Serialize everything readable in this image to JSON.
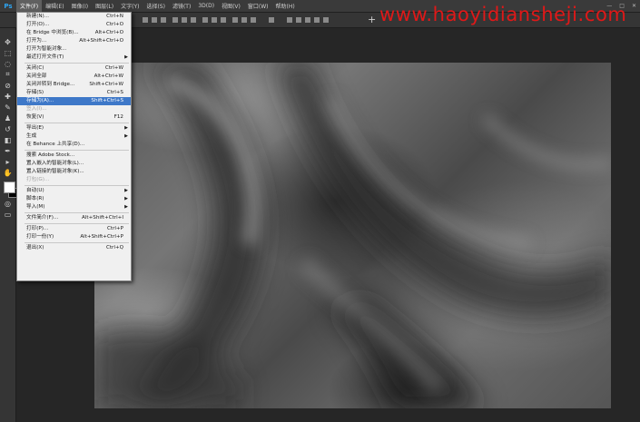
{
  "app": {
    "logo": "Ps"
  },
  "menubar": {
    "items": [
      "文件(F)",
      "编辑(E)",
      "图像(I)",
      "图层(L)",
      "文字(Y)",
      "选择(S)",
      "滤镜(T)",
      "3D(D)",
      "视图(V)",
      "窗口(W)",
      "帮助(H)"
    ]
  },
  "window_controls": [
    "—",
    "□",
    "✕"
  ],
  "watermark": "www.haoyidiansheji.com",
  "file_menu": {
    "items": [
      {
        "label": "新建(N)...",
        "shortcut": "Ctrl+N"
      },
      {
        "label": "打开(O)...",
        "shortcut": "Ctrl+O"
      },
      {
        "label": "在 Bridge 中浏览(B)...",
        "shortcut": "Alt+Ctrl+O"
      },
      {
        "label": "打开为...",
        "shortcut": "Alt+Shift+Ctrl+O"
      },
      {
        "label": "打开为智能对象...",
        "shortcut": ""
      },
      {
        "label": "最近打开文件(T)",
        "shortcut": "",
        "submenu": true
      },
      {
        "separator": true
      },
      {
        "label": "关闭(C)",
        "shortcut": "Ctrl+W"
      },
      {
        "label": "关闭全部",
        "shortcut": "Alt+Ctrl+W"
      },
      {
        "label": "关闭并转到 Bridge...",
        "shortcut": "Shift+Ctrl+W"
      },
      {
        "label": "存储(S)",
        "shortcut": "Ctrl+S"
      },
      {
        "label": "存储为(A)...",
        "shortcut": "Shift+Ctrl+S",
        "highlight": true
      },
      {
        "label": "签入(I)...",
        "shortcut": "",
        "disabled": true
      },
      {
        "label": "恢复(V)",
        "shortcut": "F12"
      },
      {
        "separator": true
      },
      {
        "label": "导出(E)",
        "shortcut": "",
        "submenu": true
      },
      {
        "label": "生成",
        "shortcut": "",
        "submenu": true
      },
      {
        "label": "在 Behance 上共享(D)...",
        "shortcut": ""
      },
      {
        "separator": true
      },
      {
        "label": "搜索 Adobe Stock...",
        "shortcut": ""
      },
      {
        "label": "置入嵌入的智能对象(L)...",
        "shortcut": ""
      },
      {
        "label": "置入链接的智能对象(K)...",
        "shortcut": ""
      },
      {
        "label": "打包(G)...",
        "shortcut": "",
        "disabled": true
      },
      {
        "separator": true
      },
      {
        "label": "自动(U)",
        "shortcut": "",
        "submenu": true
      },
      {
        "label": "脚本(R)",
        "shortcut": "",
        "submenu": true
      },
      {
        "label": "导入(M)",
        "shortcut": "",
        "submenu": true
      },
      {
        "separator": true
      },
      {
        "label": "文件简介(F)...",
        "shortcut": "Alt+Shift+Ctrl+I"
      },
      {
        "separator": true
      },
      {
        "label": "打印(P)...",
        "shortcut": "Ctrl+P"
      },
      {
        "label": "打印一份(Y)",
        "shortcut": "Alt+Shift+Ctrl+P"
      },
      {
        "separator": true
      },
      {
        "label": "退出(X)",
        "shortcut": "Ctrl+Q"
      }
    ]
  },
  "colors": {
    "foreground": "#ffffff",
    "background": "#000000",
    "highlight": "#3e78c8",
    "watermark": "#e01818"
  }
}
